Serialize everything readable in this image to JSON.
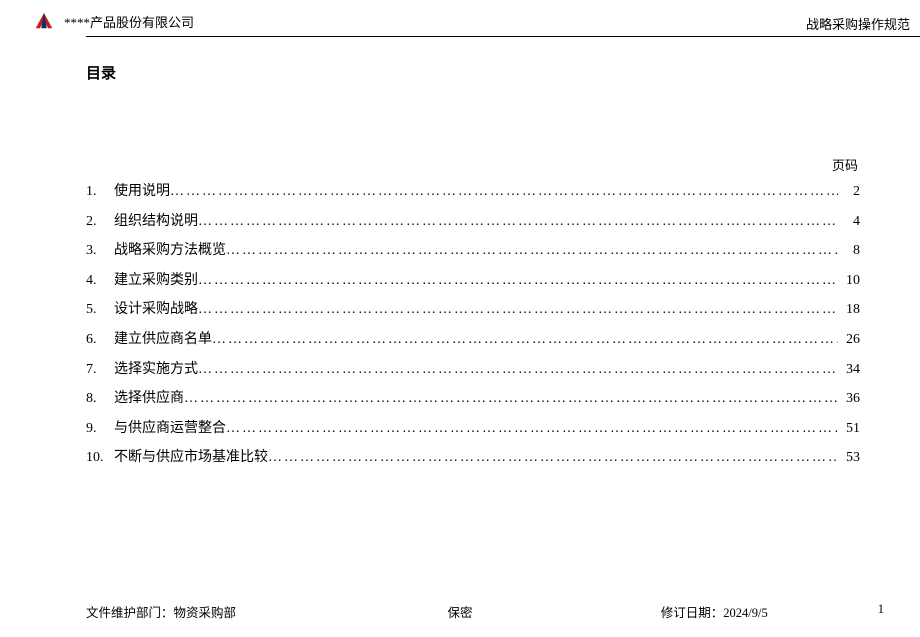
{
  "header": {
    "company": "****产品股份有限公司",
    "doc_title": "战略采购操作规范"
  },
  "toc": {
    "heading": "目录",
    "page_label": "页码",
    "items": [
      {
        "num": "1.",
        "title": "使用说明",
        "page": "2"
      },
      {
        "num": "2.",
        "title": "组织结构说明",
        "page": "4"
      },
      {
        "num": "3.",
        "title": "战略采购方法概览",
        "page": "8"
      },
      {
        "num": "4.",
        "title": "建立采购类别",
        "page": "10"
      },
      {
        "num": "5.",
        "title": "设计采购战略",
        "page": "18"
      },
      {
        "num": "6.",
        "title": "建立供应商名单",
        "page": "26"
      },
      {
        "num": "7.",
        "title": "选择实施方式",
        "page": "34"
      },
      {
        "num": "8.",
        "title": "选择供应商",
        "page": "36"
      },
      {
        "num": "9.",
        "title": "与供应商运营整合",
        "page": "51"
      },
      {
        "num": "10.",
        "title": "不断与供应市场基准比较",
        "page": "53"
      }
    ]
  },
  "footer": {
    "dept_label": "文件维护部门：",
    "dept_value": "物资采购部",
    "confidential": "保密",
    "date_label": "修订日期：",
    "date_value": "2024/9/5",
    "page_number": "1"
  }
}
